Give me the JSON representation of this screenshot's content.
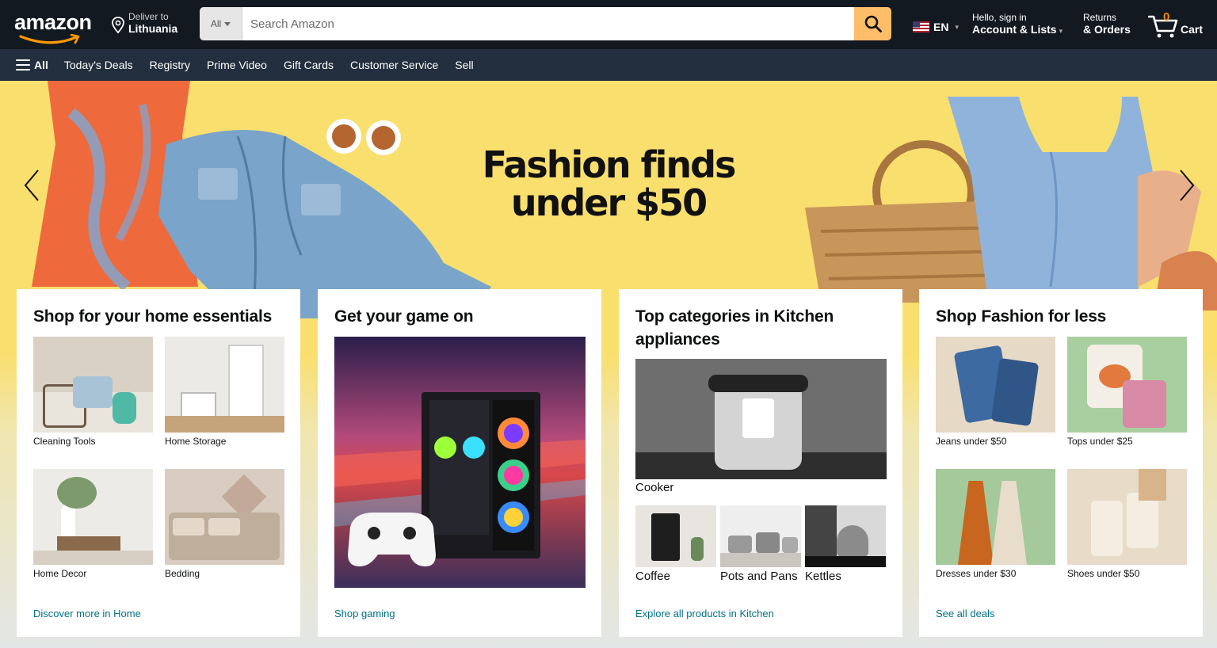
{
  "header": {
    "logo_text": "amazon",
    "deliver_label": "Deliver to",
    "deliver_location": "Lithuania",
    "search_category": "All",
    "search_placeholder": "Search Amazon",
    "language": "EN",
    "account_greeting": "Hello, sign in",
    "account_label": "Account & Lists",
    "returns_label": "Returns",
    "orders_label": "& Orders",
    "cart_count": "0",
    "cart_label": "Cart",
    "accent_color": "#febd69",
    "icons": [
      "location-pin-icon",
      "search-icon",
      "us-flag-icon",
      "cart-icon",
      "menu-icon"
    ]
  },
  "subnav": {
    "all_label": "All",
    "items": [
      "Today's Deals",
      "Registry",
      "Prime Video",
      "Gift Cards",
      "Customer Service",
      "Sell"
    ]
  },
  "hero": {
    "line1": "Fashion finds",
    "line2": "under $50",
    "background_color": "#f9df6e"
  },
  "cards": [
    {
      "title": "Shop for your home essentials",
      "tiles": [
        "Cleaning Tools",
        "Home Storage",
        "Home Decor",
        "Bedding"
      ],
      "link": "Discover more in Home"
    },
    {
      "title": "Get your game on",
      "link": "Shop gaming"
    },
    {
      "title": "Top categories in Kitchen appliances",
      "main_label": "Cooker",
      "tiles": [
        "Coffee",
        "Pots and Pans",
        "Kettles"
      ],
      "link": "Explore all products in Kitchen"
    },
    {
      "title": "Shop Fashion for less",
      "tiles": [
        "Jeans under $50",
        "Tops under $25",
        "Dresses under $30",
        "Shoes under $50"
      ],
      "link": "See all deals"
    }
  ]
}
